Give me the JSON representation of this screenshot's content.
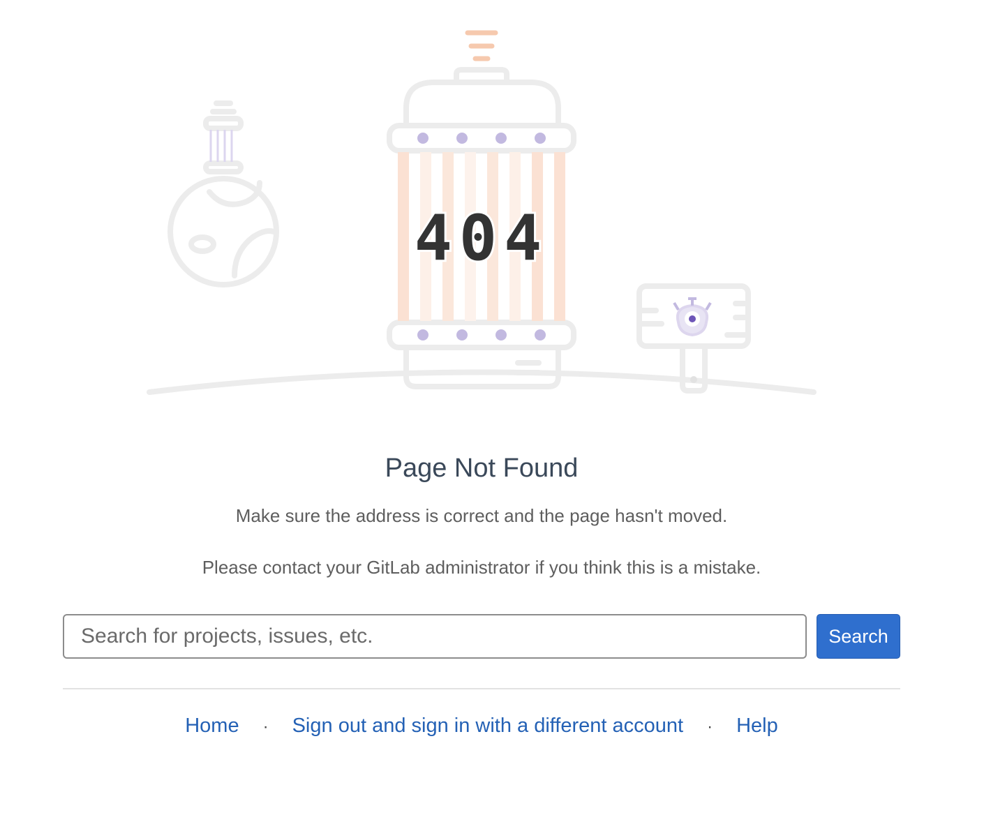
{
  "illustration": {
    "code": "404",
    "accent_color": "#f6c9ae",
    "purple_color": "#c2b9e0",
    "line_color": "#ececec"
  },
  "page": {
    "title": "Page Not Found",
    "message_1": "Make sure the address is correct and the page hasn't moved.",
    "message_2": "Please contact your GitLab administrator if you think this is a mistake."
  },
  "search": {
    "placeholder": "Search for projects, issues, etc.",
    "button_label": "Search",
    "button_color": "#2f6fce"
  },
  "footer": {
    "links": [
      {
        "label": "Home"
      },
      {
        "label": "Sign out and sign in with a different account"
      },
      {
        "label": "Help"
      }
    ],
    "separator": "·",
    "link_color": "#2461b5"
  }
}
